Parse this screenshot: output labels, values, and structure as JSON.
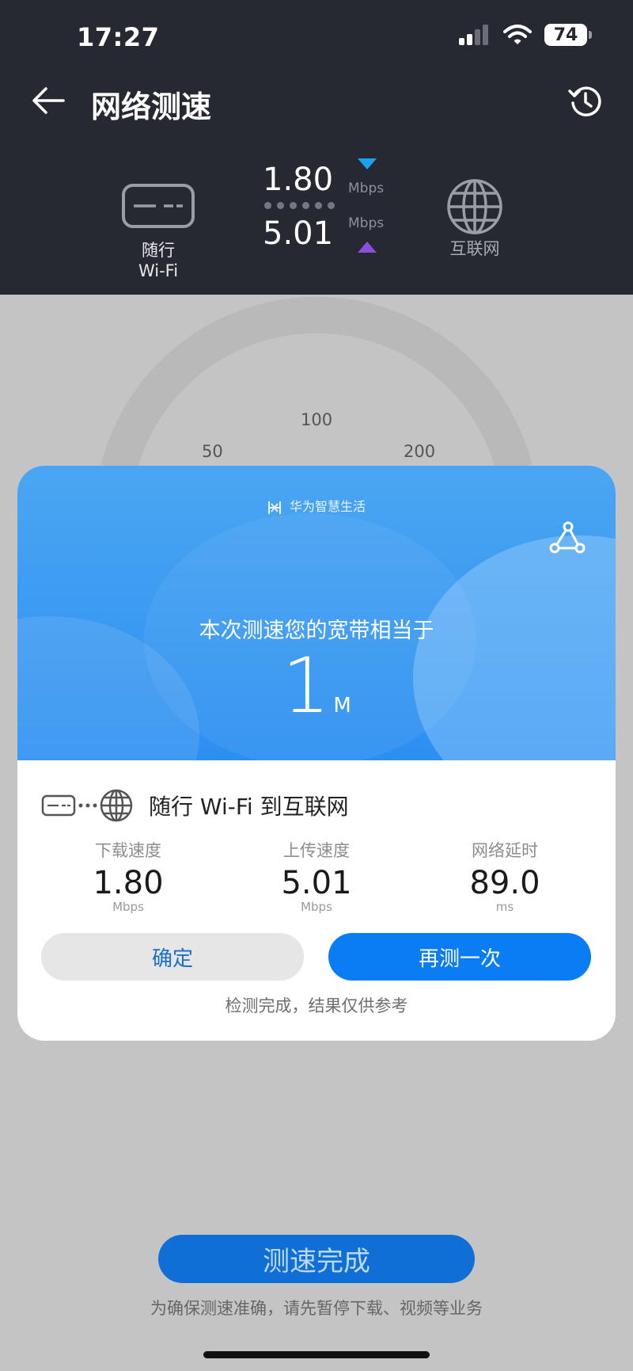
{
  "status_bar": {
    "time": "17:27",
    "battery": "74"
  },
  "header": {
    "title": "网络测速",
    "router_label_line1": "随行",
    "router_label_line2": "Wi-Fi",
    "internet_label": "互联网",
    "download_value": "1.80",
    "upload_value": "5.01",
    "download_unit": "Mbps",
    "upload_unit": "Mbps"
  },
  "gauge": {
    "tick_50": "50",
    "tick_100": "100",
    "tick_200": "200"
  },
  "result_card": {
    "brand": "华为智慧生活",
    "equiv_text": "本次测速您的宽带相当于",
    "equiv_value": "1",
    "equiv_unit": "M",
    "route_text": "随行 Wi-Fi 到互联网",
    "stats": [
      {
        "label": "下载速度",
        "value": "1.80",
        "unit": "Mbps"
      },
      {
        "label": "上传速度",
        "value": "5.01",
        "unit": "Mbps"
      },
      {
        "label": "网络延时",
        "value": "89.0",
        "unit": "ms"
      }
    ],
    "ok_button": "确定",
    "retry_button": "再测一次",
    "note": "检测完成，结果仅供参考"
  },
  "bottom": {
    "button": "测速完成",
    "note": "为确保测速准确，请先暂停下载、视频等业务"
  },
  "colors": {
    "header_bg": "#262932",
    "accent_blue": "#0a7df5",
    "download_arrow": "#1da0f0",
    "upload_arrow": "#8b4fe0"
  }
}
